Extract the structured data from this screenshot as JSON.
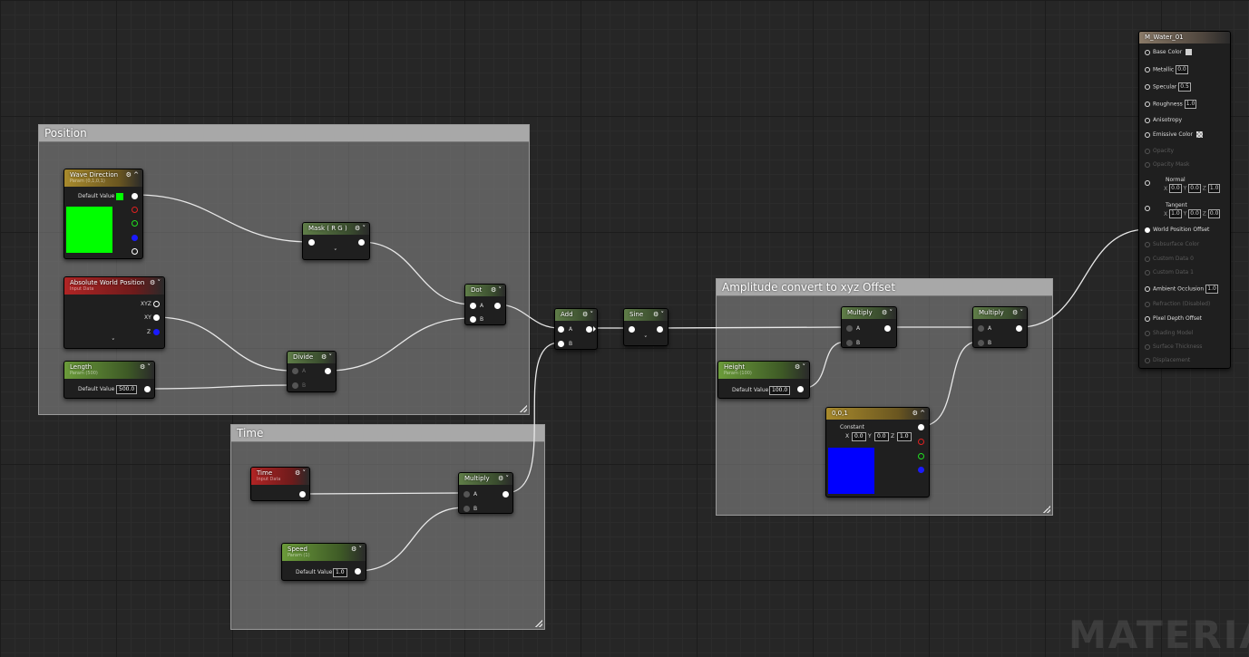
{
  "comments": {
    "position": "Position",
    "time": "Time",
    "amplitude": "Amplitude convert to xyz Offset"
  },
  "colors": {
    "wave_direction_swatch": "#00ff00",
    "constant_swatch": "#0000ff",
    "base_color_swatch": "#d0d0d0"
  },
  "nodes": {
    "wave_direction": {
      "title": "Wave Direction",
      "subtitle": "Param (0,1,0,1)",
      "default_label": "Default Value"
    },
    "abs_world_pos": {
      "title": "Absolute World Position",
      "subtitle": "Input Data",
      "pins": [
        "XYZ",
        "XY",
        "Z"
      ]
    },
    "length": {
      "title": "Length",
      "subtitle": "Param (500)",
      "default_label": "Default Value",
      "default_value": "500.0"
    },
    "mask": {
      "title": "Mask ( R G )"
    },
    "divide": {
      "title": "Divide",
      "pin_a": "A",
      "pin_b": "B"
    },
    "dot": {
      "title": "Dot",
      "pin_a": "A",
      "pin_b": "B"
    },
    "add": {
      "title": "Add",
      "pin_a": "A",
      "pin_b": "B"
    },
    "sine": {
      "title": "Sine"
    },
    "time": {
      "title": "Time",
      "subtitle": "Input Data"
    },
    "speed": {
      "title": "Speed",
      "subtitle": "Param (1)",
      "default_label": "Default Value",
      "default_value": "1.0"
    },
    "multiply_time": {
      "title": "Multiply",
      "pin_a": "A",
      "pin_b": "B"
    },
    "height": {
      "title": "Height",
      "subtitle": "Param (100)",
      "default_label": "Default Value",
      "default_value": "100.0"
    },
    "multiply_1": {
      "title": "Multiply",
      "pin_a": "A",
      "pin_b": "B"
    },
    "multiply_2": {
      "title": "Multiply",
      "pin_a": "A",
      "pin_b": "B"
    },
    "constant": {
      "title": "0,0,1",
      "label": "Constant",
      "x": "0.0",
      "y": "0.0",
      "z": "1.0",
      "xl": "X",
      "yl": "Y",
      "zl": "Z"
    }
  },
  "material": {
    "title": "M_Water_01",
    "base_color": "Base Color",
    "metallic": "Metallic",
    "metallic_value": "0.0",
    "specular": "Specular",
    "specular_value": "0.5",
    "roughness": "Roughness",
    "roughness_value": "1.0",
    "anisotropy": "Anisotropy",
    "emissive": "Emissive Color",
    "opacity": "Opacity",
    "opacity_mask": "Opacity Mask",
    "normal": "Normal",
    "normal_x": "0.0",
    "normal_y": "0.0",
    "normal_z": "1.0",
    "tangent": "Tangent",
    "tangent_x": "1.0",
    "tangent_y": "0.0",
    "tangent_z": "0.0",
    "xl": "X",
    "yl": "Y",
    "zl": "Z",
    "wpo": "World Position Offset",
    "subsurface": "Subsurface Color",
    "custom0": "Custom Data 0",
    "custom1": "Custom Data 1",
    "ao": "Ambient Occlusion",
    "ao_value": "1.0",
    "refraction": "Refraction (Disabled)",
    "pdo": "Pixel Depth Offset",
    "shading": "Shading Model",
    "surface": "Surface Thickness",
    "displacement": "Displacement"
  },
  "watermark": "MATERIAL"
}
